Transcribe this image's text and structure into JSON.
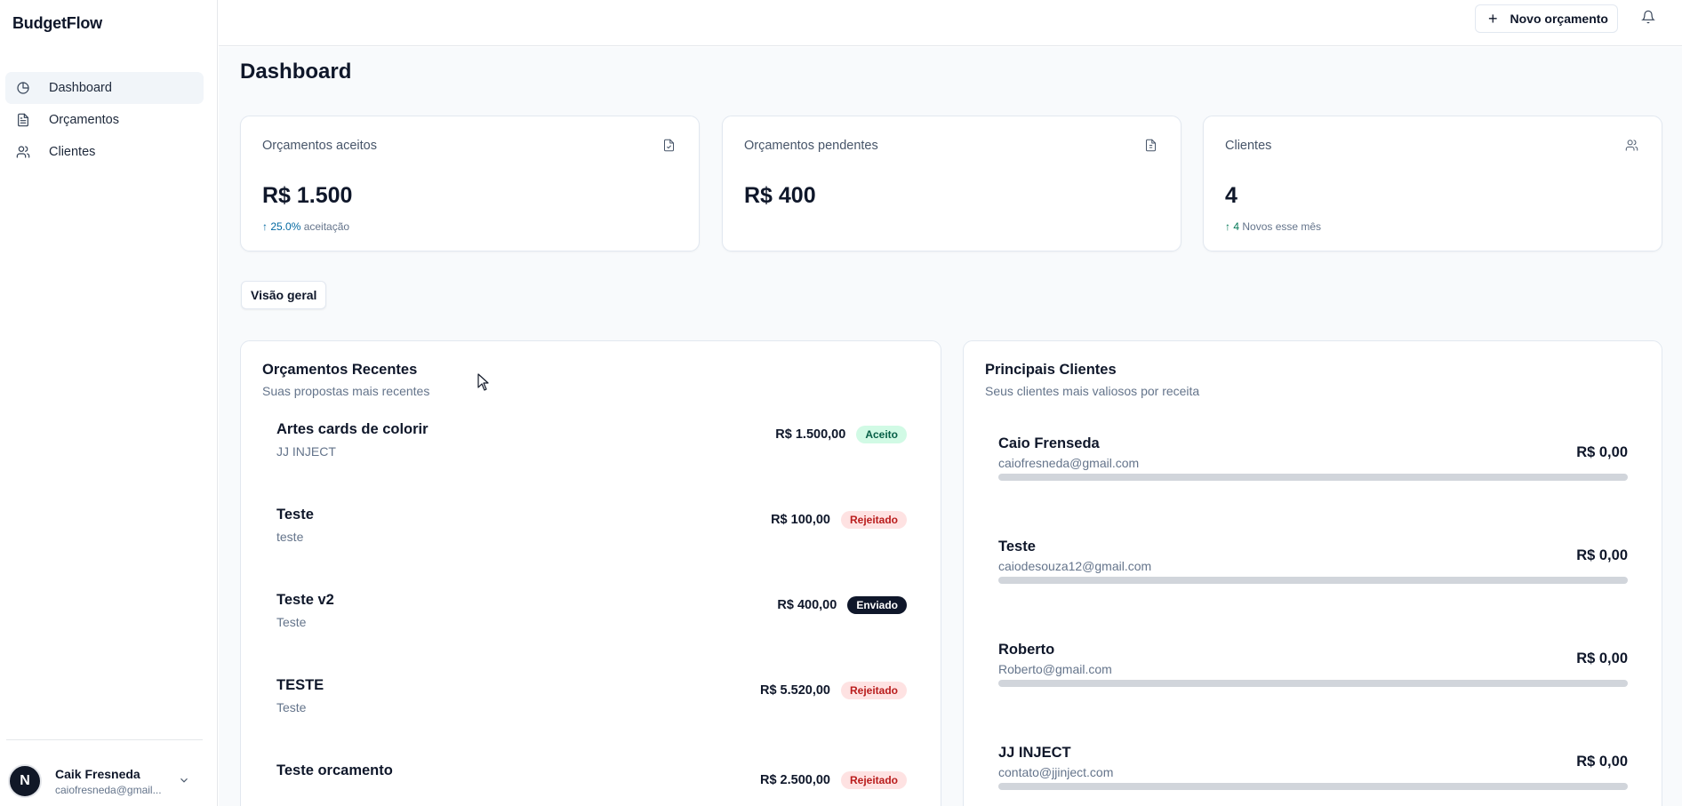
{
  "app": {
    "brand": "BudgetFlow"
  },
  "sidebar": {
    "items": [
      {
        "label": "Dashboard",
        "icon": "pie-chart-icon",
        "active": true
      },
      {
        "label": "Orçamentos",
        "icon": "document-icon",
        "active": false
      },
      {
        "label": "Clientes",
        "icon": "users-icon",
        "active": false
      }
    ],
    "user": {
      "initial": "N",
      "name": "Caik Fresneda",
      "email": "caiofresneda@gmail..."
    }
  },
  "header": {
    "new_budget_label": "Novo orçamento"
  },
  "page": {
    "title": "Dashboard"
  },
  "stats": [
    {
      "label": "Orçamentos aceitos",
      "value": "R$ 1.500",
      "trend": "↑ 25.0%",
      "trend_text": "aceitação",
      "icon": "file-icon"
    },
    {
      "label": "Orçamentos pendentes",
      "value": "R$ 400",
      "trend": "",
      "trend_text": "",
      "icon": "file-icon"
    },
    {
      "label": "Clientes",
      "value": "4",
      "trend": "↑ 4",
      "trend_text": "Novos esse mês",
      "icon": "users-icon"
    }
  ],
  "tabs": {
    "overview_label": "Visão geral"
  },
  "recent_quotes": {
    "title": "Orçamentos Recentes",
    "subtitle": "Suas propostas mais recentes",
    "items": [
      {
        "name": "Artes cards de colorir",
        "client": "JJ INJECT",
        "price": "R$ 1.500,00",
        "status": "Aceito",
        "status_type": "aceito"
      },
      {
        "name": "Teste",
        "client": "teste",
        "price": "R$ 100,00",
        "status": "Rejeitado",
        "status_type": "rejeitado"
      },
      {
        "name": "Teste v2",
        "client": "Teste",
        "price": "R$ 400,00",
        "status": "Enviado",
        "status_type": "enviado"
      },
      {
        "name": "TESTE",
        "client": "Teste",
        "price": "R$ 5.520,00",
        "status": "Rejeitado",
        "status_type": "rejeitado"
      },
      {
        "name": "Teste orcamento",
        "client": "",
        "price": "R$ 2.500,00",
        "status": "Rejeitado",
        "status_type": "rejeitado"
      }
    ]
  },
  "top_clients": {
    "title": "Principais Clientes",
    "subtitle": "Seus clientes mais valiosos por receita",
    "items": [
      {
        "name": "Caio Frenseda",
        "email": "caiofresneda@gmail.com",
        "value": "R$ 0,00",
        "share": 0
      },
      {
        "name": "Teste",
        "email": "caiodesouza12@gmail.com",
        "value": "R$ 0,00",
        "share": 0
      },
      {
        "name": "Roberto",
        "email": "Roberto@gmail.com",
        "value": "R$ 0,00",
        "share": 0
      },
      {
        "name": "JJ INJECT",
        "email": "contato@jjinject.com",
        "value": "R$ 0,00",
        "share": 0
      }
    ]
  }
}
